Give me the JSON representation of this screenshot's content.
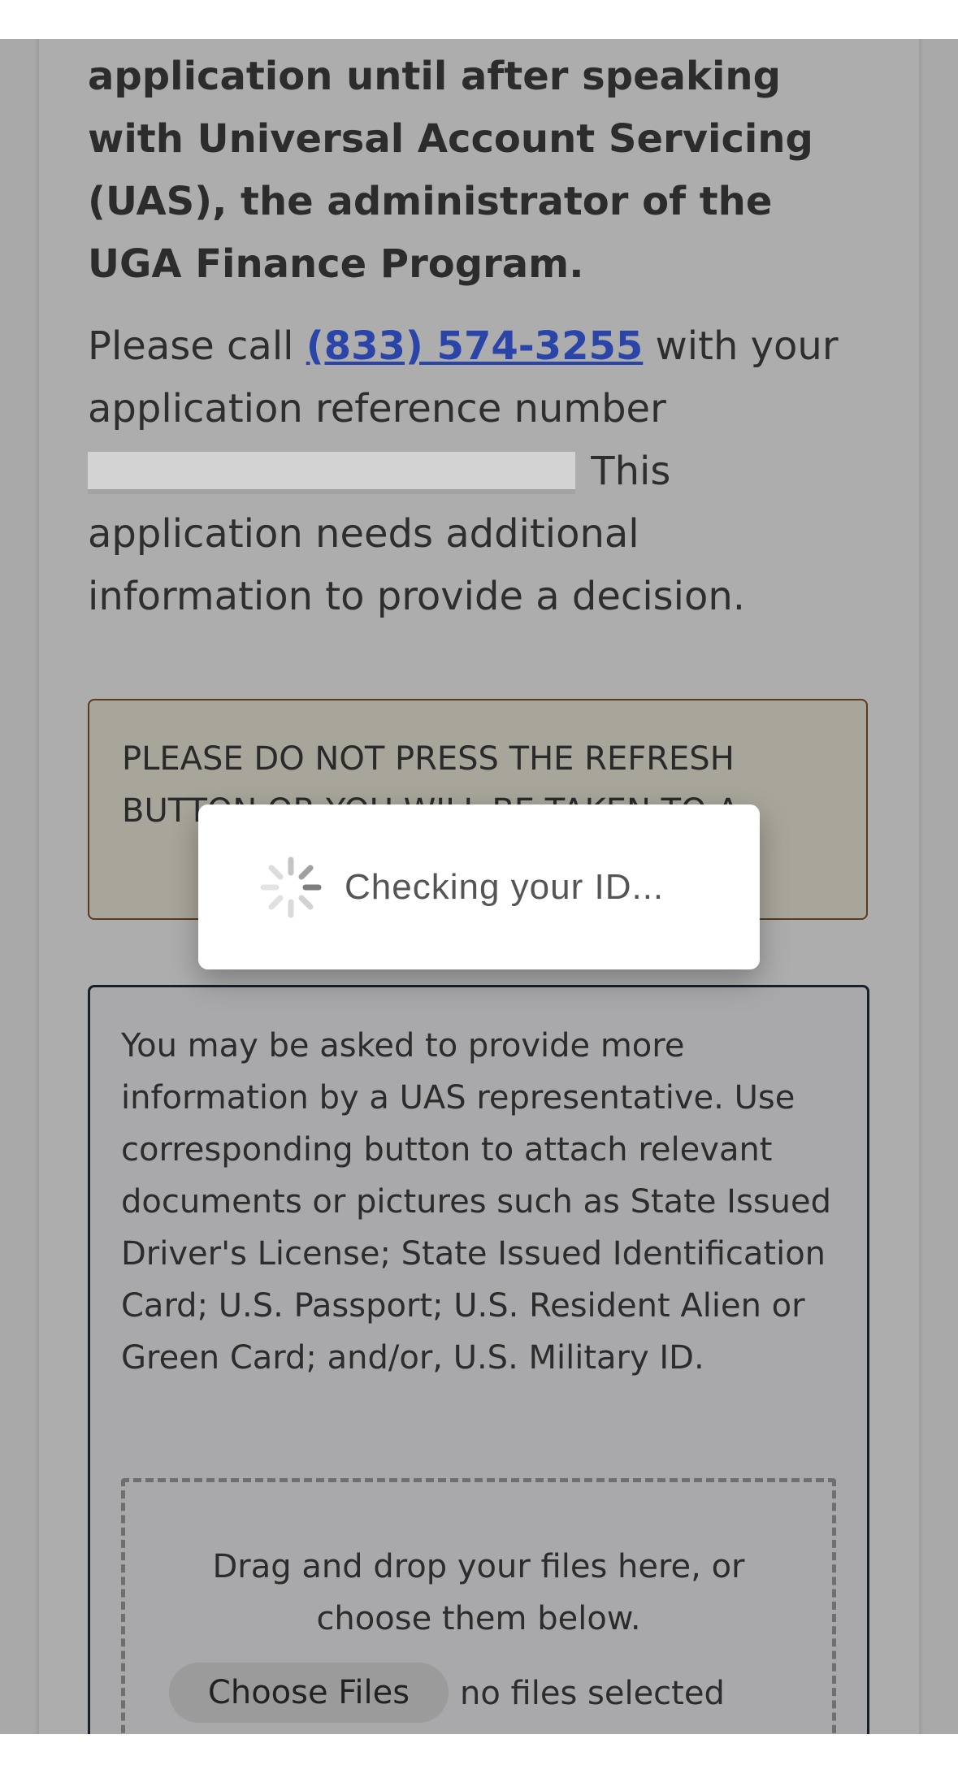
{
  "warning": {
    "heading": "Please do not refresh the application until after speaking with Universal Account Servicing (UAS), the administrator of the UGA Finance Program."
  },
  "call_instructions": {
    "prefix": "Please call ",
    "phone": "(833) 574-3255",
    "middle": " with your application reference number ",
    "suffix": " This application needs additional information to provide a decision."
  },
  "alert": {
    "text": "PLEASE DO NOT PRESS THE REFRESH BUTTON OR YOU WILL BE TAKEN TO A"
  },
  "info": {
    "text": "You may be asked to provide more information by a UAS representative. Use corresponding button to attach relevant documents or pictures such as State Issued Driver's License; State Issued Identification Card; U.S. Passport; U.S. Resident Alien or Green Card; and/or, U.S. Military ID."
  },
  "upload": {
    "drop_text": "Drag and drop your files here, or choose them below.",
    "choose_label": "Choose Files",
    "status": "no files selected"
  },
  "modal": {
    "message": "Checking your ID...",
    "icon": "loading-spinner-icon"
  },
  "colors": {
    "overlay": "#a9a9a9",
    "link": "#2a44a8",
    "alert_border": "#5b3a1e",
    "info_border": "#1a1f2c"
  }
}
